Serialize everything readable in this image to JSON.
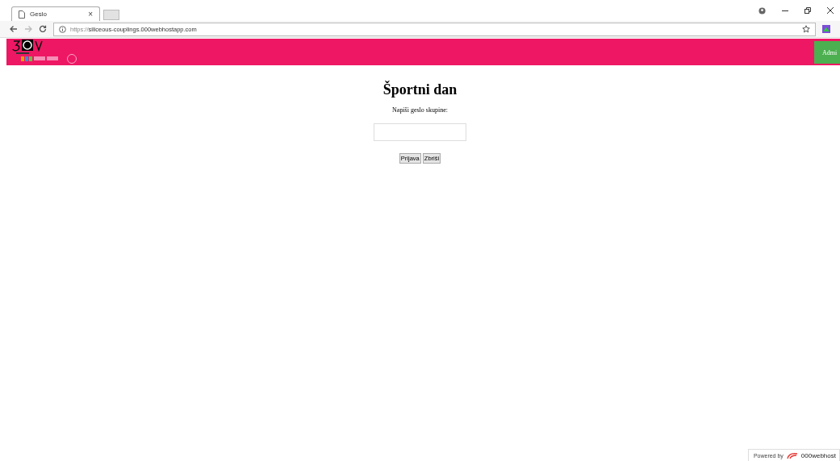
{
  "browser": {
    "tab_title": "Geslo",
    "tab_close": "×",
    "url_scheme": "https://",
    "url_host": "siliceous-couplings.000webhostapp.com"
  },
  "header": {
    "admin_button": "Admi"
  },
  "main": {
    "title": "Športni dan",
    "prompt": "Napiši geslo skupine:",
    "buttons": [
      "Prijava",
      "Zbriši"
    ]
  },
  "footer": {
    "powered_by": "Powered by",
    "brand": "000webhost"
  }
}
